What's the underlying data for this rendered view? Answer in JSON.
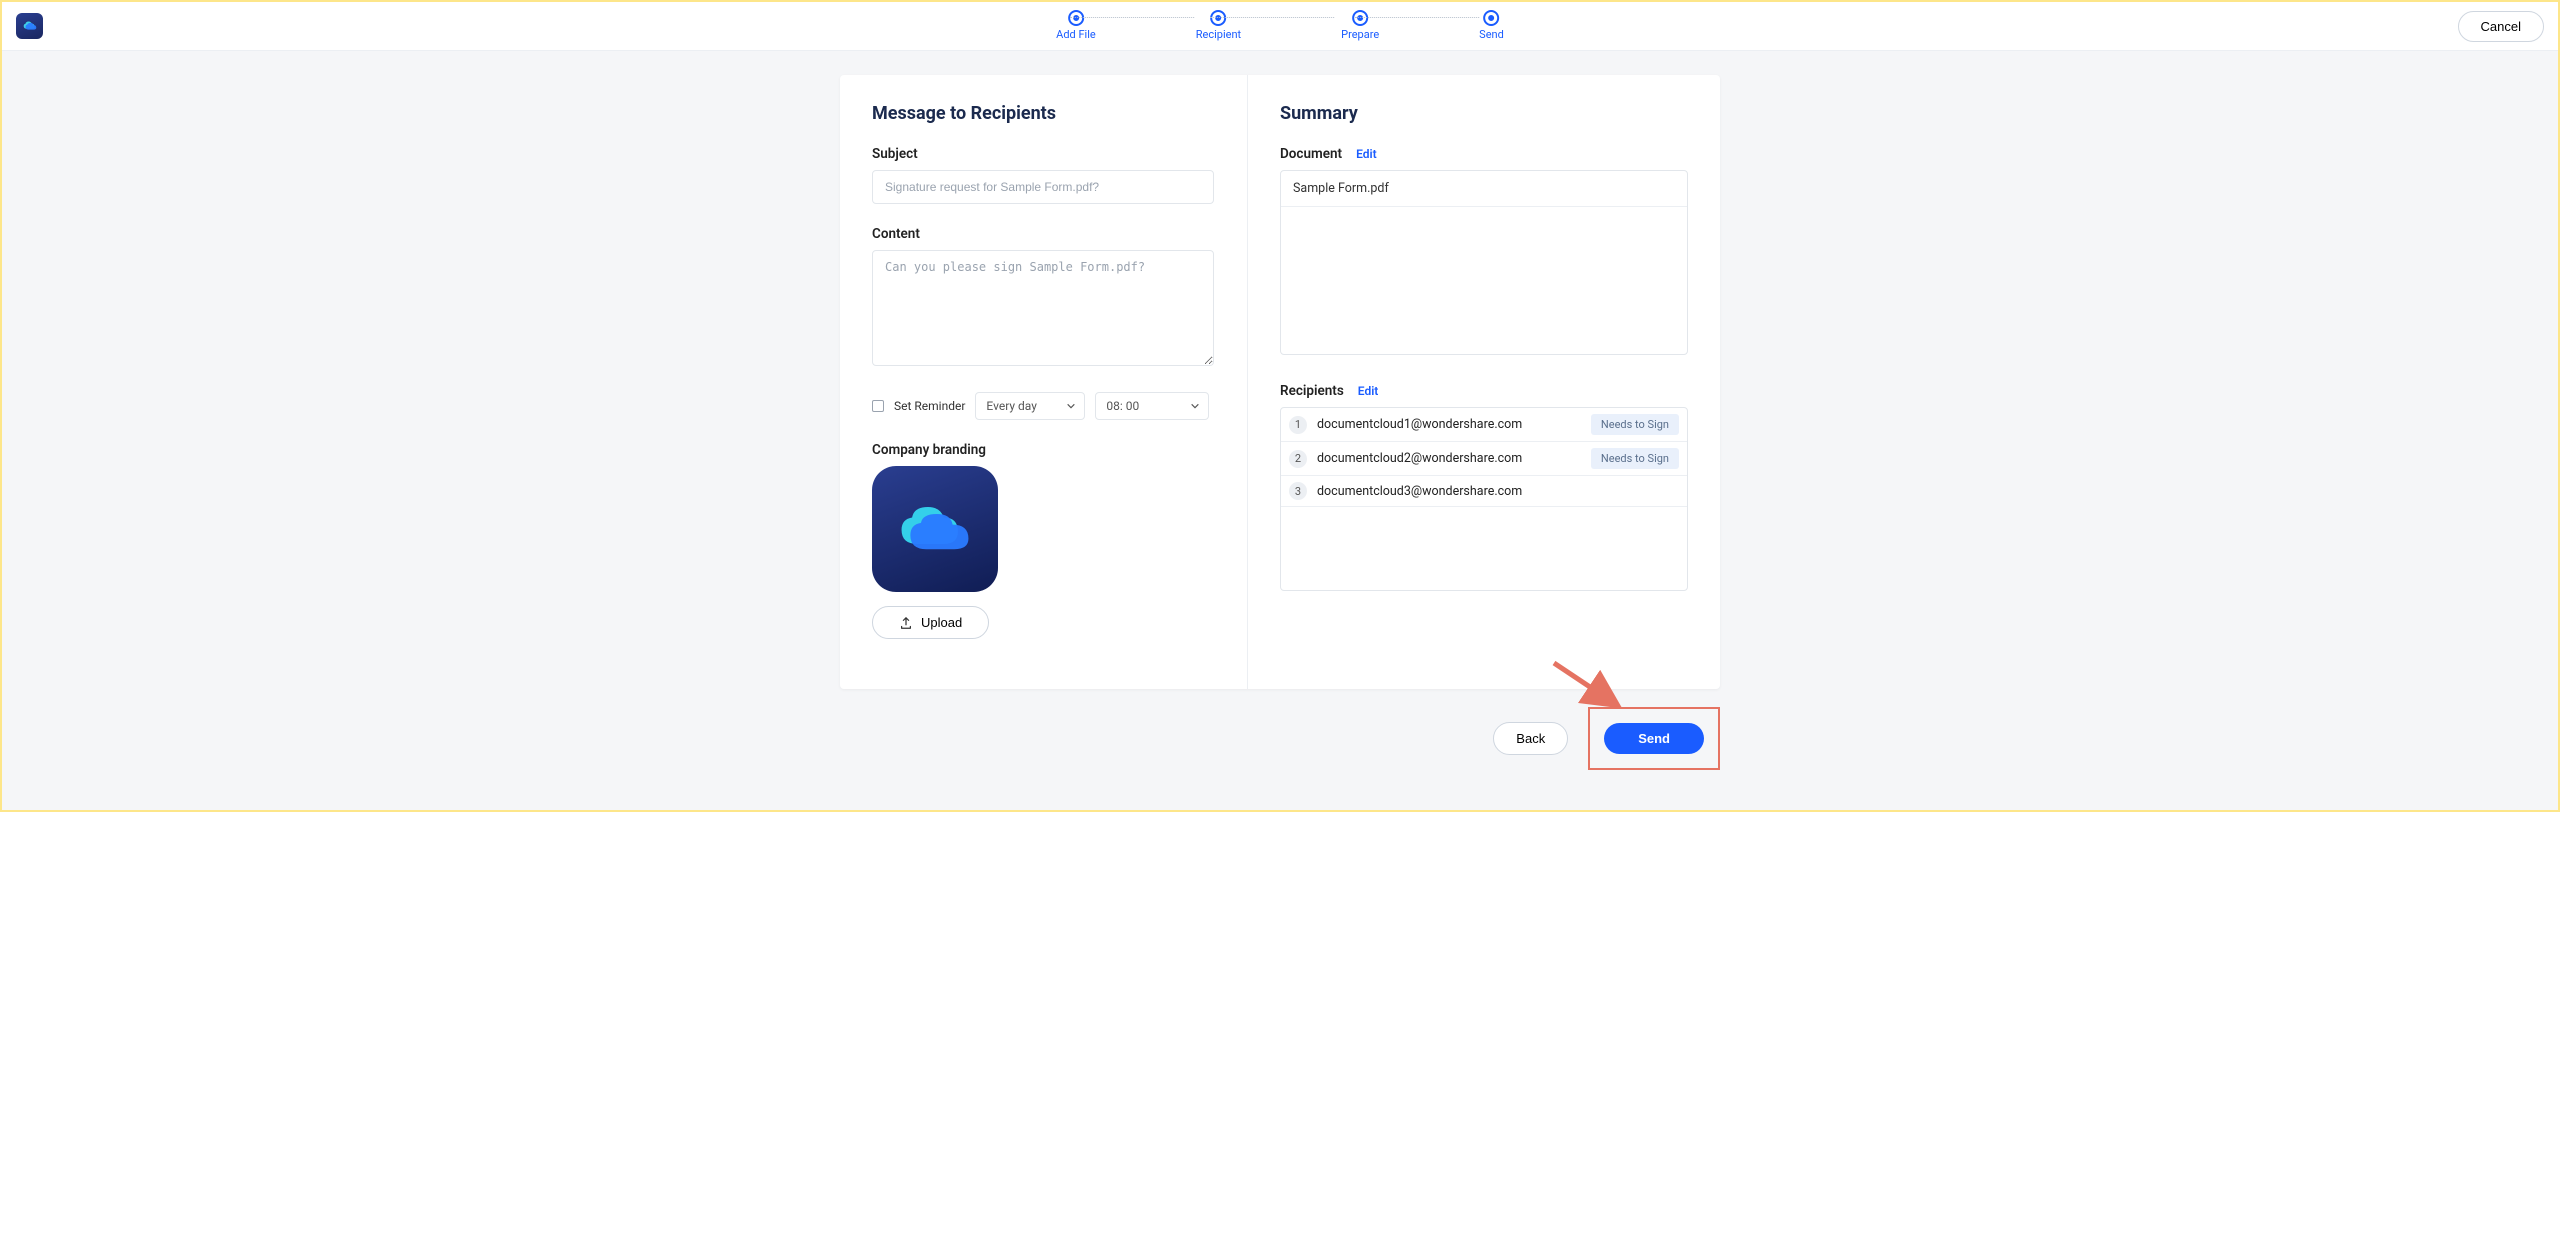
{
  "header": {
    "steps": [
      "Add File",
      "Recipient",
      "Prepare",
      "Send"
    ],
    "cancel": "Cancel"
  },
  "left": {
    "title": "Message to Recipients",
    "subject_label": "Subject",
    "subject_placeholder": "Signature request for Sample Form.pdf?",
    "content_label": "Content",
    "content_placeholder": "Can you please sign Sample Form.pdf?",
    "reminder_label": "Set Reminder",
    "reminder_freq": "Every day",
    "reminder_time": "08: 00",
    "branding_label": "Company branding",
    "upload": "Upload"
  },
  "right": {
    "title": "Summary",
    "document_label": "Document",
    "edit": "Edit",
    "document_name": "Sample Form.pdf",
    "recipients_label": "Recipients",
    "recipients": [
      {
        "num": "1",
        "email": "documentcloud1@wondershare.com",
        "badge": "Needs to Sign"
      },
      {
        "num": "2",
        "email": "documentcloud2@wondershare.com",
        "badge": "Needs to Sign"
      },
      {
        "num": "3",
        "email": "documentcloud3@wondershare.com",
        "badge": ""
      }
    ]
  },
  "footer": {
    "back": "Back",
    "send": "Send"
  }
}
